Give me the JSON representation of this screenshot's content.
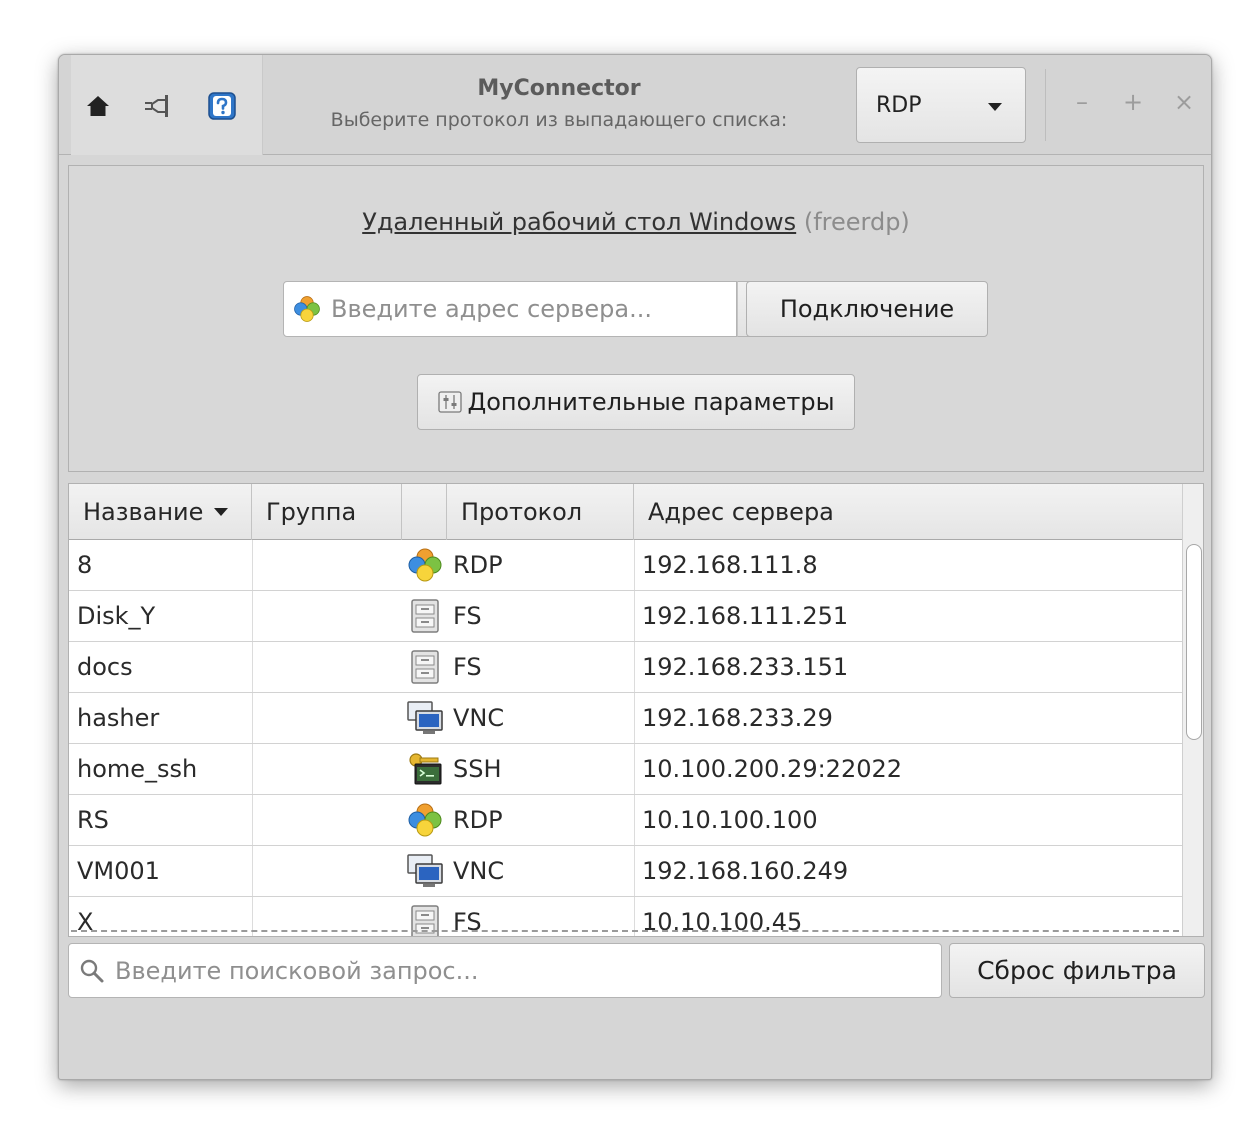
{
  "app": {
    "title": "MyConnector",
    "subtitle": "Выберите протокол из выпадающего списка:"
  },
  "protocol_select": {
    "selected": "RDP"
  },
  "window_controls": {
    "minimize": "–",
    "maximize": "+",
    "close": "×"
  },
  "connect_panel": {
    "heading_link": "Удаленный рабочий стол Windows",
    "heading_client": "(freerdp)",
    "server_placeholder": "Введите адрес сервера...",
    "connect_label": "Подключение",
    "advanced_label": "Дополнительные параметры"
  },
  "table": {
    "columns": [
      "Название",
      "Группа",
      "",
      "Протокол",
      "Адрес сервера"
    ],
    "sort_column": "Название",
    "rows": [
      {
        "name": "8",
        "group": "",
        "icon": "rdp-icon",
        "protocol": "RDP",
        "address": "192.168.111.8"
      },
      {
        "name": "Disk_Y",
        "group": "",
        "icon": "fs-icon",
        "protocol": "FS",
        "address": "192.168.111.251"
      },
      {
        "name": "docs",
        "group": "",
        "icon": "fs-icon",
        "protocol": "FS",
        "address": "192.168.233.151"
      },
      {
        "name": "hasher",
        "group": "",
        "icon": "vnc-icon",
        "protocol": "VNC",
        "address": "192.168.233.29"
      },
      {
        "name": "home_ssh",
        "group": "",
        "icon": "ssh-icon",
        "protocol": "SSH",
        "address": "10.100.200.29:22022"
      },
      {
        "name": "RS",
        "group": "",
        "icon": "rdp-icon",
        "protocol": "RDP",
        "address": "10.10.100.100"
      },
      {
        "name": "VM001",
        "group": "",
        "icon": "vnc-icon",
        "protocol": "VNC",
        "address": "192.168.160.249"
      },
      {
        "name": "X",
        "group": "",
        "icon": "fs-icon",
        "protocol": "FS",
        "address": "10.10.100.45"
      }
    ]
  },
  "search": {
    "placeholder": "Введите поисковой запрос...",
    "reset_label": "Сброс фильтра"
  },
  "colors": {
    "window_bg": "#d6d6d6",
    "help_icon_blue": "#2f76c8",
    "rdp_orange": "#f0a030",
    "rdp_green": "#7cc243",
    "rdp_blue": "#3d8ee0",
    "rdp_yellow": "#f7d43b"
  }
}
